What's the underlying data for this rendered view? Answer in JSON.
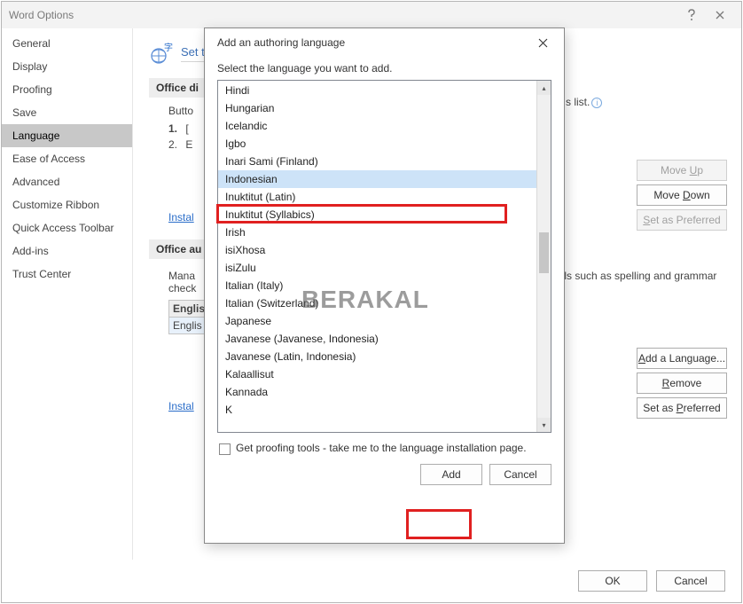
{
  "window": {
    "title": "Word Options"
  },
  "sidebar": {
    "items": [
      {
        "label": "General"
      },
      {
        "label": "Display"
      },
      {
        "label": "Proofing"
      },
      {
        "label": "Save"
      },
      {
        "label": "Language"
      },
      {
        "label": "Ease of Access"
      },
      {
        "label": "Advanced"
      },
      {
        "label": "Customize Ribbon"
      },
      {
        "label": "Quick Access Toolbar"
      },
      {
        "label": "Add-ins"
      },
      {
        "label": "Trust Center"
      }
    ],
    "selected_index": 4
  },
  "page": {
    "heading": "Set the Office Language Preferences",
    "section1": {
      "title": "Office di",
      "subtitle": "Butto",
      "row1_num": "1.",
      "row1_text": "[",
      "row2_num": "2.",
      "row2_text": "E",
      "hint_tail": "s list.",
      "link": "Instal"
    },
    "section2": {
      "title": "Office au",
      "desc_a": "Mana",
      "desc_b": "check",
      "tail": "ools such as spelling and grammar",
      "table_hdr": "Englis",
      "table_row": "Englis",
      "link": "Instal"
    },
    "buttons_top": {
      "moveup": "Move Up",
      "movedown": "Move Down",
      "setpref": "Set as Preferred"
    },
    "buttons_bot": {
      "addlang": "Add a Language...",
      "remove": "Remove",
      "setpref": "Set as Preferred"
    },
    "footer": {
      "ok": "OK",
      "cancel": "Cancel"
    }
  },
  "dialog": {
    "title": "Add an authoring language",
    "prompt": "Select the language you want to add.",
    "languages": [
      "Hindi",
      "Hungarian",
      "Icelandic",
      "Igbo",
      "Inari Sami (Finland)",
      "Indonesian",
      "Inuktitut (Latin)",
      "Inuktitut (Syllabics)",
      "Irish",
      "isiXhosa",
      "isiZulu",
      "Italian (Italy)",
      "Italian (Switzerland)",
      "Japanese",
      "Javanese (Javanese, Indonesia)",
      "Javanese (Latin, Indonesia)",
      "Kalaallisut",
      "Kannada",
      "K"
    ],
    "selected_index": 5,
    "checkbox_label": "Get proofing tools - take me to the language installation page.",
    "add": "Add",
    "cancel": "Cancel"
  },
  "watermark": "BERAKAL"
}
